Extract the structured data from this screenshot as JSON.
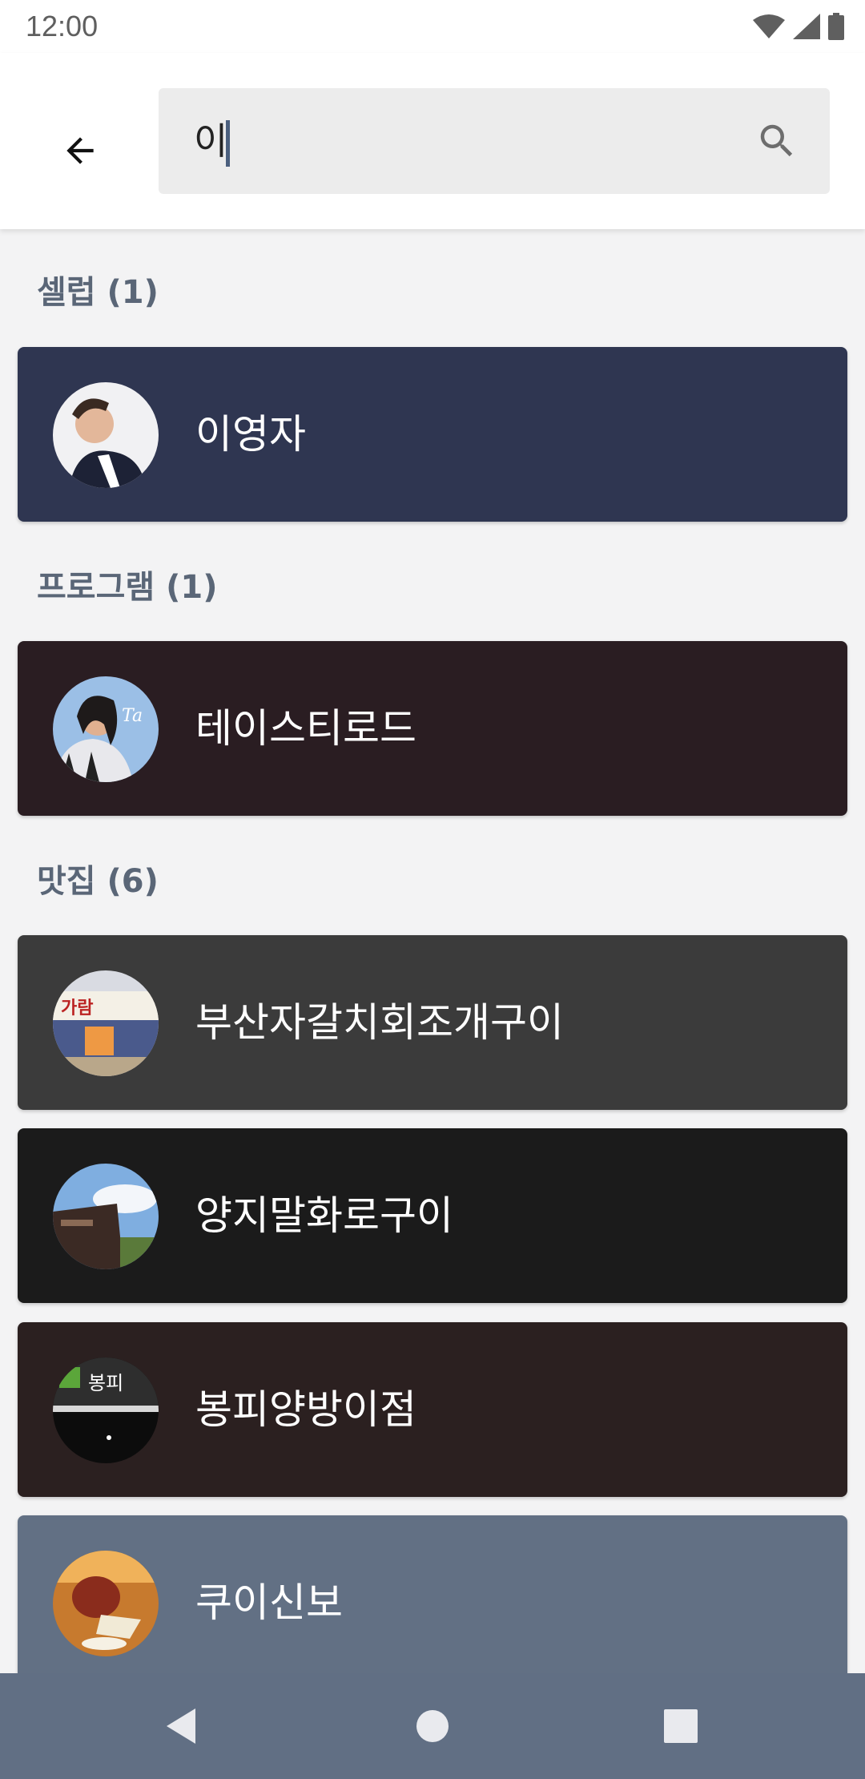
{
  "status_bar": {
    "time": "12:00"
  },
  "search": {
    "query": "이"
  },
  "sections": [
    {
      "title": "셀럽 (1)",
      "items": [
        {
          "name": "이영자",
          "bg": "#2f3651"
        }
      ]
    },
    {
      "title": "프로그램 (1)",
      "items": [
        {
          "name": "테이스티로드",
          "bg": "#2a1d22"
        }
      ]
    },
    {
      "title": "맛집 (6)",
      "items": [
        {
          "name": "부산자갈치회조개구이",
          "bg": "#3b3b3b"
        },
        {
          "name": "양지말화로구이",
          "bg": "#1b1b1b"
        },
        {
          "name": "봉피양방이점",
          "bg": "#2b2020"
        },
        {
          "name": "쿠이신보",
          "bg": "#627084"
        }
      ]
    }
  ],
  "icons": {
    "back": "arrow-left-icon",
    "search": "search-icon",
    "nav": [
      "back-triangle-icon",
      "home-circle-icon",
      "recents-square-icon"
    ]
  },
  "colors": {
    "nav_bar": "#616f84",
    "section_title": "#5a6677"
  }
}
